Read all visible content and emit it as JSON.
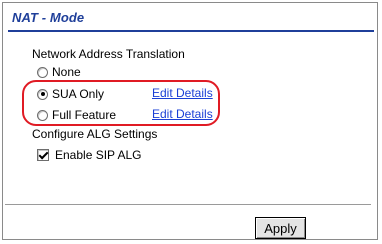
{
  "header": {
    "title": "NAT - Mode"
  },
  "nat": {
    "section_label": "Network Address Translation",
    "options": [
      {
        "label": "None",
        "selected": false
      },
      {
        "label": "SUA Only",
        "selected": true,
        "link": "Edit Details"
      },
      {
        "label": "Full Feature",
        "selected": false,
        "link": "Edit Details"
      }
    ]
  },
  "alg": {
    "section_label": "Configure ALG Settings",
    "sip_label": "Enable SIP ALG",
    "sip_checked": true
  },
  "footer": {
    "apply_label": "Apply"
  },
  "colors": {
    "title": "#1f3f9a",
    "link": "#1a3fd6",
    "highlight": "#e01b24"
  }
}
